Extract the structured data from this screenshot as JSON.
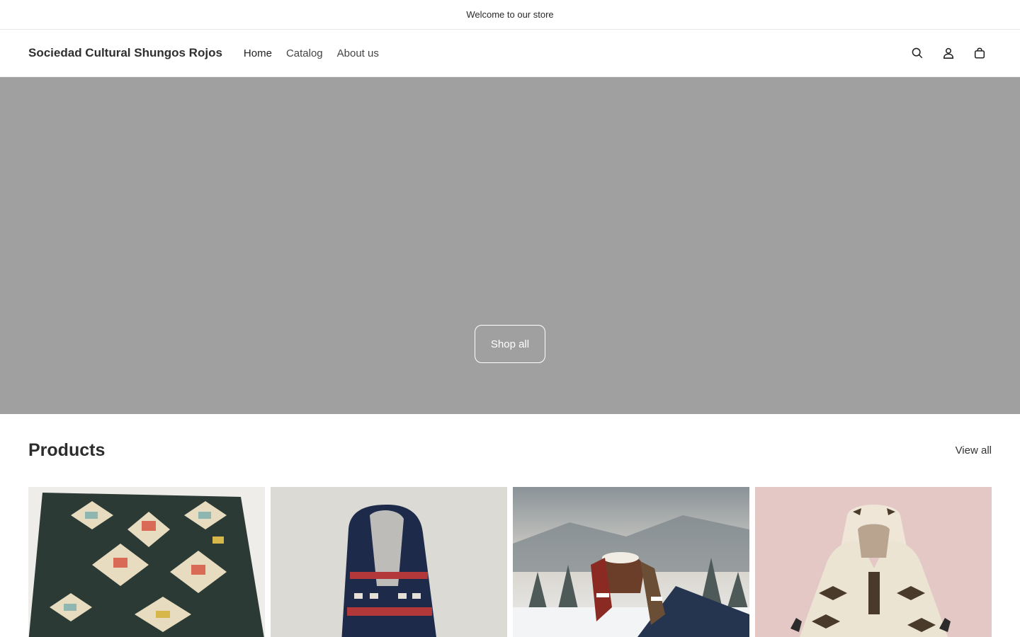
{
  "announcement": {
    "text": "Welcome to our store"
  },
  "header": {
    "logo": "Sociedad Cultural Shungos Rojos",
    "nav": [
      {
        "label": "Home"
      },
      {
        "label": "Catalog"
      },
      {
        "label": "About us"
      }
    ],
    "icons": [
      "search-icon",
      "account-icon",
      "cart-icon"
    ]
  },
  "hero": {
    "button_label": "Shop all",
    "background": "#a0a0a0"
  },
  "products": {
    "title": "Products",
    "view_all": "View all",
    "cards": [
      {
        "image": "geometric-pattern-blanket"
      },
      {
        "image": "hooded-knit-sweater"
      },
      {
        "image": "mittens-holding-cocoa-snow"
      },
      {
        "image": "hooded-alpaca-poncho"
      }
    ]
  }
}
